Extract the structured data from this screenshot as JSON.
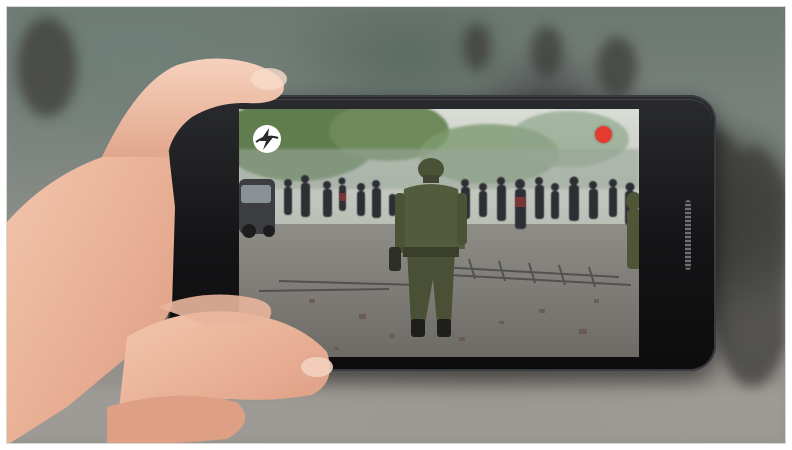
{
  "scene": {
    "description_free": true,
    "accent_colors": {
      "record_indicator": "#e53a2f",
      "logo_badge": "#ffffff",
      "phone_body": "#141416"
    }
  },
  "phone": {
    "screen": {
      "overlay_logo_icon": "lightning-logo-icon",
      "record_indicator_icon": "record-dot-icon"
    }
  }
}
